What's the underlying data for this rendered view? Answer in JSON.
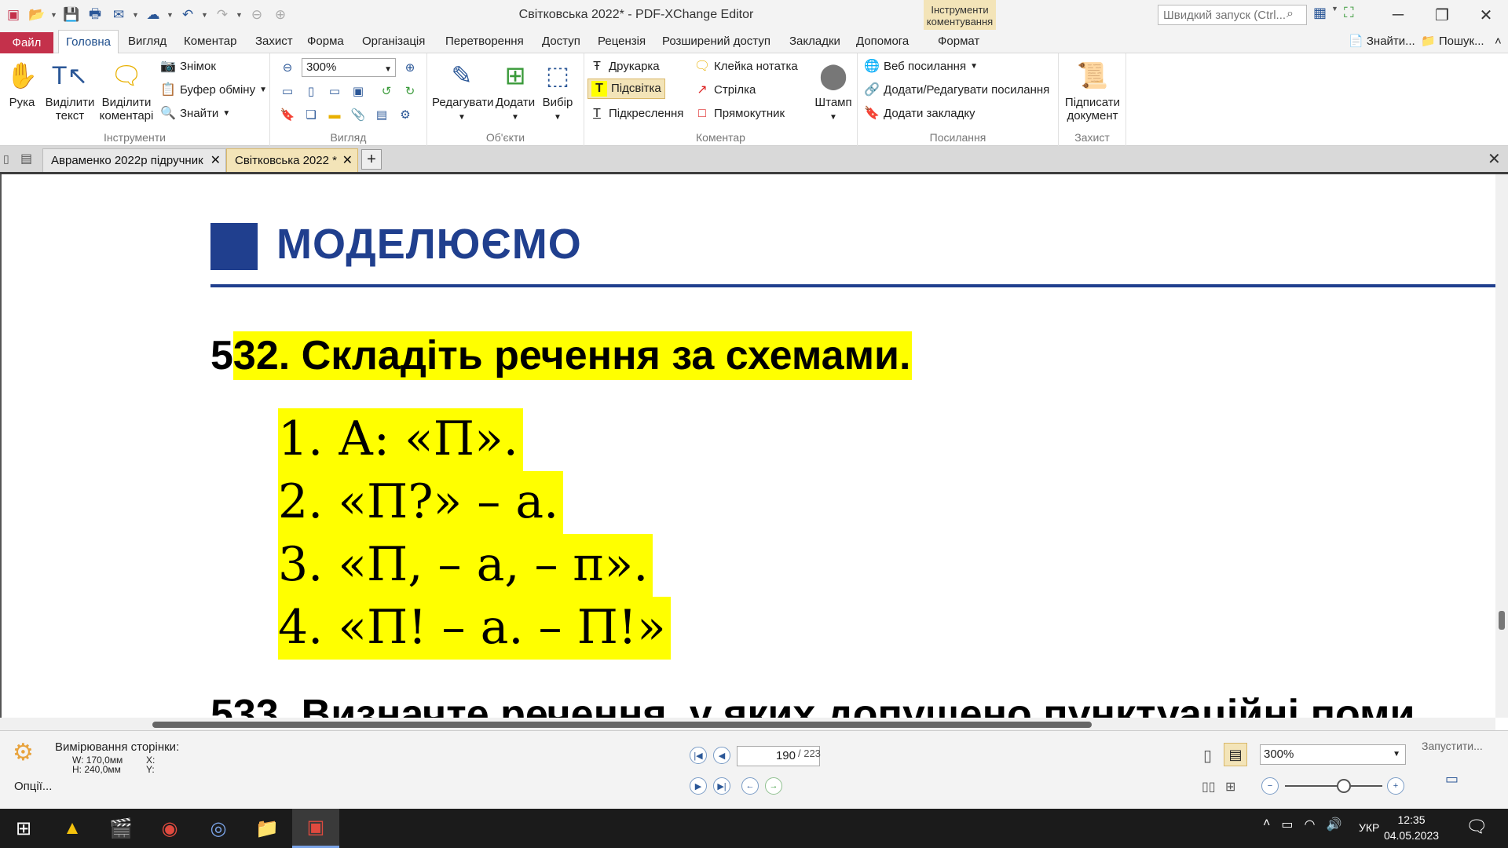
{
  "window": {
    "title": "Світковська 2022* - PDF-XChange Editor",
    "context_group": "Інструменти коментування"
  },
  "quick_search": {
    "placeholder": "Швидкий запуск (Ctrl..."
  },
  "menu": {
    "items": [
      "Файл",
      "Головна",
      "Вигляд",
      "Коментар",
      "Захист",
      "Форма",
      "Організація",
      "Перетворення",
      "Доступ",
      "Рецензія",
      "Розширений доступ",
      "Закладки",
      "Допомога",
      "Формат"
    ],
    "find": "Знайти...",
    "search": "Пошук..."
  },
  "ribbon": {
    "tools": {
      "hand": "Рука",
      "select_text": [
        "Виділити",
        "текст"
      ],
      "select_comments": [
        "Виділити",
        "коментарі"
      ],
      "snapshot": "Знімок",
      "clipboard": "Буфер обміну",
      "find": "Знайти",
      "label": "Інструменти"
    },
    "view": {
      "zoom": "300%",
      "label": "Вигляд"
    },
    "objects": {
      "edit": "Редагувати",
      "add": "Додати",
      "select": "Вибір",
      "label": "Об'єкти"
    },
    "comment": {
      "typewriter": "Друкарка",
      "highlight": "Підсвітка",
      "underline": "Підкреслення",
      "sticky": "Клейка нотатка",
      "arrow": "Стрілка",
      "rectangle": "Прямокутник",
      "stamp": "Штамп",
      "label": "Коментар"
    },
    "links": {
      "web": "Веб посилання",
      "add_edit": "Додати/Редагувати посилання",
      "bookmark": "Додати закладку",
      "label": "Посилання"
    },
    "protect": {
      "sign": [
        "Підписати",
        "документ"
      ],
      "label": "Захист"
    }
  },
  "tabs": [
    {
      "label": "Авраменко 2022р підручник",
      "active": false
    },
    {
      "label": "Світковська 2022 *",
      "active": true
    }
  ],
  "document": {
    "section_title": "МОДЕЛЮЄМО",
    "task532_num": "5",
    "task532_rest": "32.  Складіть речення за схемами.",
    "schemas": [
      "1. А: «П».",
      "2. «П?» – а.",
      "3. «П, – а, – п».",
      "4. «П! – а. – П!»"
    ],
    "task533": "533.  Визначте речення, у яких допущено пунктуаційні поми"
  },
  "status": {
    "measure_title": "Вимірювання сторінки:",
    "width": "W: 170,0мм",
    "height": "H: 240,0мм",
    "x": "X:",
    "y": "Y:",
    "options": "Опції...",
    "page_current": "190",
    "page_total": "/ 223",
    "zoom": "300%",
    "run": "Запустити..."
  },
  "taskbar": {
    "lang": "УКР",
    "time": "12:35",
    "date": "04.05.2023"
  },
  "colors": {
    "accent": "#203f8e",
    "highlight": "#ffff00",
    "file_menu": "#c4314b"
  }
}
